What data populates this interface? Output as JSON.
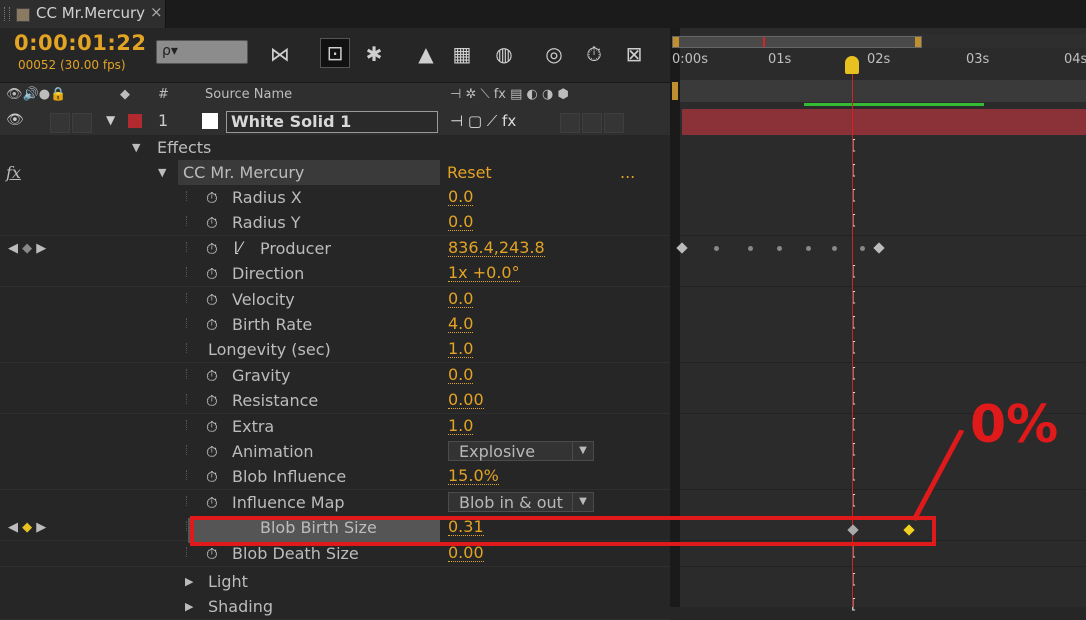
{
  "window": {
    "tab_title": "CC Mr.Mercury",
    "close_glyph": "×"
  },
  "toolbar": {
    "timecode": "0:00:01:22",
    "frames": "00052 (30.00 fps)",
    "search_glyph": "ρ▾"
  },
  "columns": {
    "source_name": "Source Name",
    "number": "#"
  },
  "layer": {
    "index": "1",
    "name": "White Solid 1",
    "color": "#b02a30"
  },
  "tree": {
    "effects": "Effects",
    "effect_name": "CC Mr. Mercury",
    "reset": "Reset",
    "ellipsis": "...",
    "fx": "fx"
  },
  "properties": [
    {
      "label": "Radius X",
      "value": "0.0"
    },
    {
      "label": "Radius Y",
      "value": "0.0"
    },
    {
      "label": "Producer",
      "value": "836.4,243.8"
    },
    {
      "label": "Direction",
      "value": "1x +0.0°"
    },
    {
      "label": "Velocity",
      "value": "0.0"
    },
    {
      "label": "Birth Rate",
      "value": "4.0"
    },
    {
      "label": "Longevity (sec)",
      "value": "1.0"
    },
    {
      "label": "Gravity",
      "value": "0.0"
    },
    {
      "label": "Resistance",
      "value": "0.00"
    },
    {
      "label": "Extra",
      "value": "1.0"
    },
    {
      "label": "Animation",
      "value": "Explosive"
    },
    {
      "label": "Blob Influence",
      "value": "15.0%"
    },
    {
      "label": "Influence Map",
      "value": "Blob in & out"
    },
    {
      "label": "Blob Birth Size",
      "value": "0.31"
    },
    {
      "label": "Blob Death Size",
      "value": "0.00"
    }
  ],
  "groups": {
    "light": "Light",
    "shading": "Shading"
  },
  "timeline": {
    "ticks": [
      "0:00s",
      "01s",
      "02s",
      "03s",
      "04s"
    ]
  },
  "annotation": {
    "text": "0%",
    "color": "#e01a1a"
  },
  "colors": {
    "accent": "#e3a324",
    "playhead": "#d22222",
    "keyframe_selected": "#f0d020"
  }
}
